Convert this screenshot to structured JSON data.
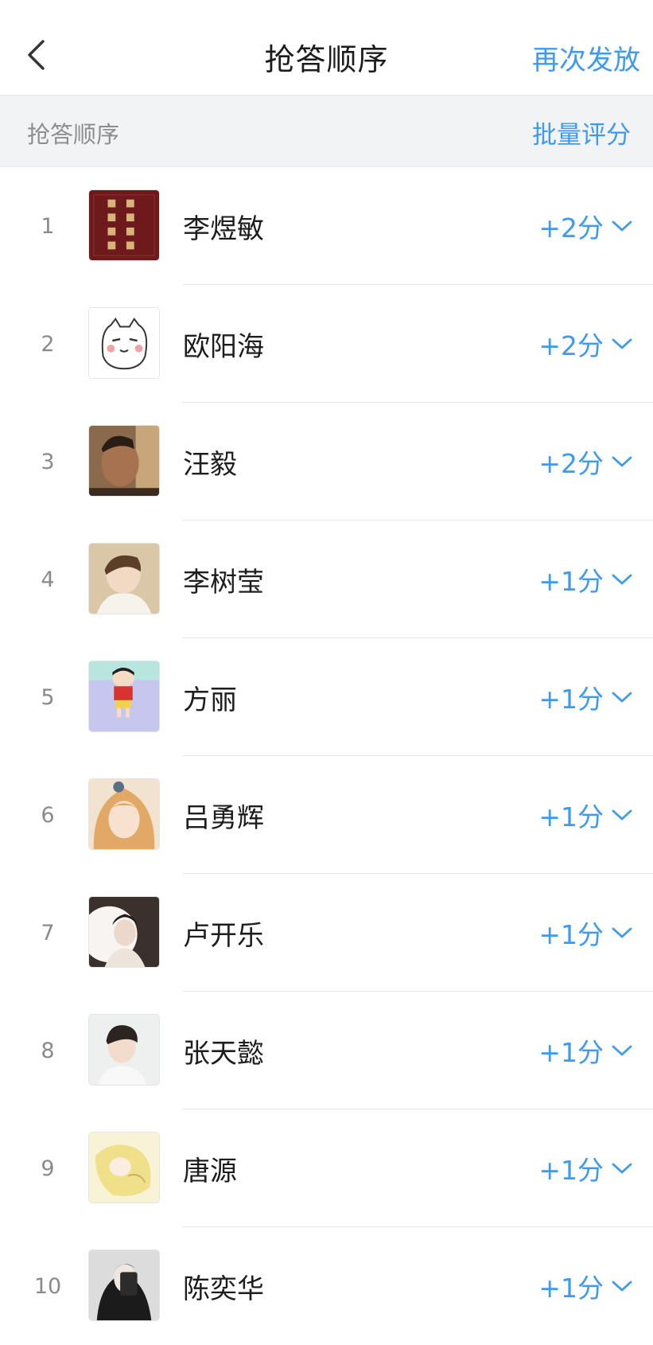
{
  "header": {
    "title": "抢答顺序",
    "action_label": "再次发放"
  },
  "subbar": {
    "label": "抢答顺序",
    "batch_label": "批量评分"
  },
  "accent_color": "#3d9af0",
  "rows": [
    {
      "rank": "1",
      "name": "李煜敏",
      "score": "+2分"
    },
    {
      "rank": "2",
      "name": "欧阳海",
      "score": "+2分"
    },
    {
      "rank": "3",
      "name": "汪毅",
      "score": "+2分"
    },
    {
      "rank": "4",
      "name": "李树莹",
      "score": "+1分"
    },
    {
      "rank": "5",
      "name": "方丽",
      "score": "+1分"
    },
    {
      "rank": "6",
      "name": "吕勇辉",
      "score": "+1分"
    },
    {
      "rank": "7",
      "name": "卢开乐",
      "score": "+1分"
    },
    {
      "rank": "8",
      "name": "张天懿",
      "score": "+1分"
    },
    {
      "rank": "9",
      "name": "唐源",
      "score": "+1分"
    },
    {
      "rank": "10",
      "name": "陈奕华",
      "score": "+1分"
    }
  ]
}
